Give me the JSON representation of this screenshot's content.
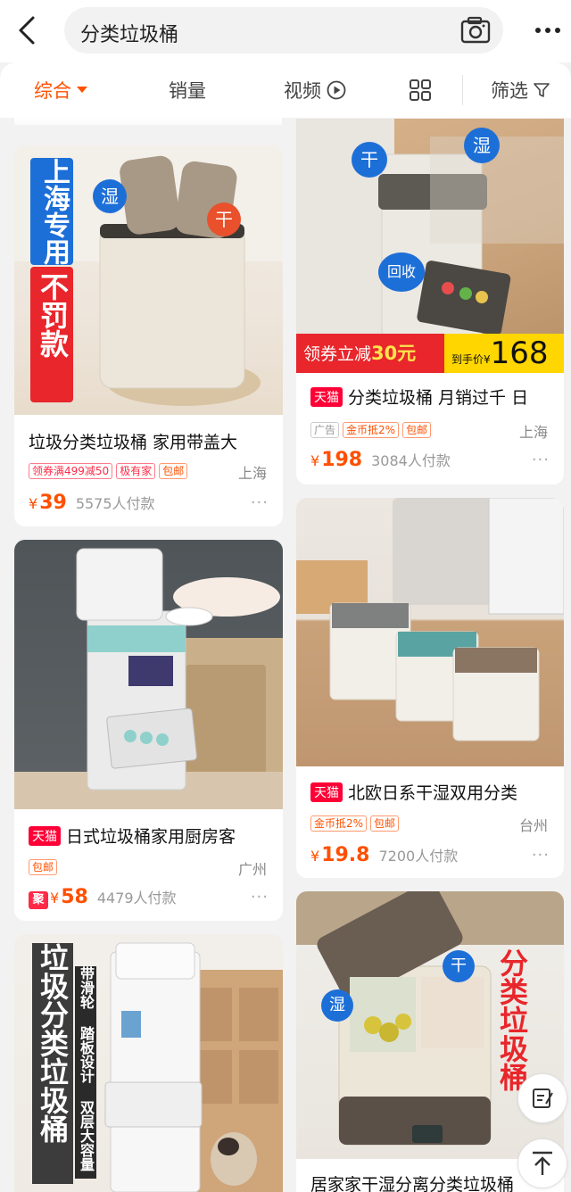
{
  "search": {
    "query": "分类垃圾桶"
  },
  "tabs": [
    {
      "label": "综合",
      "active": true
    },
    {
      "label": "销量"
    },
    {
      "label": "视频"
    },
    {
      "label": "筛选"
    }
  ],
  "products": [
    {
      "title": "垃圾分类垃圾桶 家用带盖大",
      "tags": [
        "领券满499减50",
        "极有家",
        "包邮"
      ],
      "location": "上海",
      "price": "39",
      "currency": "¥",
      "sold": "5575人付款",
      "image_texts": {
        "banner_top": "上海专用",
        "banner_bottom": "不罚款",
        "label_wet": "湿",
        "label_dry": "干"
      }
    },
    {
      "title": "分类垃圾桶 月销过千 日",
      "badge": "天猫",
      "tags": [
        "广告",
        "金币抵2%",
        "包邮"
      ],
      "location": "上海",
      "price": "198",
      "currency": "¥",
      "sold": "3084人付款",
      "image_texts": {
        "label_dry": "干",
        "label_wet": "湿",
        "label_recycle": "回收",
        "coupon": "领券立减",
        "coupon_amount": "30元",
        "hand_price_label": "到手价¥",
        "hand_price": "168"
      }
    },
    {
      "title": "日式垃圾桶家用厨房客",
      "badge": "天猫",
      "tags": [
        "包邮"
      ],
      "location": "广州",
      "price": "58",
      "currency": "¥",
      "ju": "聚",
      "sold": "4479人付款"
    },
    {
      "title": "北欧日系干湿双用分类",
      "badge": "天猫",
      "tags": [
        "金币抵2%",
        "包邮"
      ],
      "location": "台州",
      "price": "19.8",
      "currency": "¥",
      "sold": "7200人付款"
    },
    {
      "image_texts": {
        "banner": "垃圾分类垃圾桶",
        "features": "带滑轮 踏板设计 双层大容量"
      }
    },
    {
      "title": "居家家干湿分离分类垃圾桶",
      "image_texts": {
        "banner": "分类垃圾桶",
        "label_wet": "湿",
        "label_dry": "干"
      }
    }
  ],
  "more_dots": "···",
  "colors": {
    "accent": "#ff5000",
    "tmall": "#ff0036",
    "background": "#f2f2f2"
  }
}
